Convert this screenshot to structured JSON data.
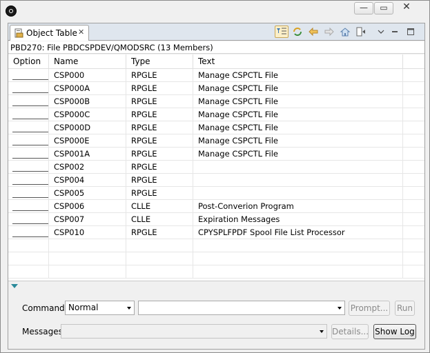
{
  "window": {
    "minimize_glyph": "—",
    "maximize_glyph": "▭",
    "close_glyph": "✕"
  },
  "tab": {
    "label": "Object Table",
    "close_glyph": "✕"
  },
  "header": {
    "text": "PBD270: File PBDCSPDEV/QMODSRC (13 Members)"
  },
  "table": {
    "columns": [
      "Option",
      "Name",
      "Type",
      "Text"
    ],
    "rows": [
      {
        "option": "",
        "name": "CSP000",
        "type": "RPGLE",
        "text": "Manage CSPCTL File"
      },
      {
        "option": "",
        "name": "CSP000A",
        "type": "RPGLE",
        "text": "Manage CSPCTL File"
      },
      {
        "option": "",
        "name": "CSP000B",
        "type": "RPGLE",
        "text": "Manage CSPCTL File"
      },
      {
        "option": "",
        "name": "CSP000C",
        "type": "RPGLE",
        "text": "Manage CSPCTL File"
      },
      {
        "option": "",
        "name": "CSP000D",
        "type": "RPGLE",
        "text": "Manage CSPCTL File"
      },
      {
        "option": "",
        "name": "CSP000E",
        "type": "RPGLE",
        "text": "Manage CSPCTL File"
      },
      {
        "option": "",
        "name": "CSP001A",
        "type": "RPGLE",
        "text": "Manage CSPCTL File"
      },
      {
        "option": "",
        "name": "CSP002",
        "type": "RPGLE",
        "text": ""
      },
      {
        "option": "",
        "name": "CSP004",
        "type": "RPGLE",
        "text": ""
      },
      {
        "option": "",
        "name": "CSP005",
        "type": "RPGLE",
        "text": ""
      },
      {
        "option": "",
        "name": "CSP006",
        "type": "CLLE",
        "text": "Post-Converion Program"
      },
      {
        "option": "",
        "name": "CSP007",
        "type": "CLLE",
        "text": "Expiration Messages"
      },
      {
        "option": "",
        "name": "CSP010",
        "type": "RPGLE",
        "text": "CPYSPLFPDF Spool File List Processor"
      }
    ]
  },
  "command": {
    "label": "Command",
    "mode": "Normal",
    "value": "",
    "prompt_label": "Prompt...",
    "run_label": "Run"
  },
  "messages": {
    "label": "Messages",
    "value": "",
    "details_label": "Details...",
    "show_log_label": "Show Log"
  }
}
